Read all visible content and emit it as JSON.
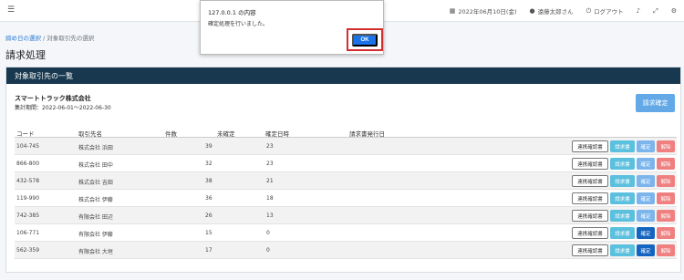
{
  "topbar": {
    "menu_icon": "hamburger-icon",
    "date_icon": "calendar-icon",
    "date": "2022年06月10日(金)",
    "user_icon": "user-icon",
    "user": "遠藤太郎さん",
    "logout_icon": "power-icon",
    "logout": "ログアウト",
    "icons": [
      "bell-icon",
      "expand-icon",
      "settings-icon"
    ]
  },
  "breadcrumb": {
    "link": "締め日の選択",
    "separator": "/",
    "current": "対象取引先の選択"
  },
  "page_title": "請求処理",
  "card": {
    "header": "対象取引先の一覧",
    "company": "スマートトラック株式会社",
    "period": "集計期間：2022-06-01〜2022-06-30",
    "confirm_button": "請求確定"
  },
  "table": {
    "headers": [
      "コード",
      "取引先名",
      "件数",
      "未確定",
      "確定日時",
      "請求書発行日"
    ],
    "rows": [
      {
        "code": "104-745",
        "name": "株式会社 浜田",
        "count": "",
        "unconfirmed": "39",
        "confirmed": "23",
        "issue": "",
        "confirm_active": false
      },
      {
        "code": "866-800",
        "name": "株式会社 田中",
        "count": "",
        "unconfirmed": "32",
        "confirmed": "23",
        "issue": "",
        "confirm_active": false
      },
      {
        "code": "432-578",
        "name": "株式会社 吉田",
        "count": "",
        "unconfirmed": "38",
        "confirmed": "21",
        "issue": "",
        "confirm_active": false
      },
      {
        "code": "119-990",
        "name": "株式会社 伊藤",
        "count": "",
        "unconfirmed": "36",
        "confirmed": "18",
        "issue": "",
        "confirm_active": false
      },
      {
        "code": "742-385",
        "name": "有限会社 田辺",
        "count": "",
        "unconfirmed": "26",
        "confirmed": "13",
        "issue": "",
        "confirm_active": false
      },
      {
        "code": "106-771",
        "name": "有限会社 伊藤",
        "count": "",
        "unconfirmed": "15",
        "confirmed": "0",
        "issue": "",
        "confirm_active": true
      },
      {
        "code": "562-359",
        "name": "有限会社 大垣",
        "count": "",
        "unconfirmed": "17",
        "confirmed": "0",
        "issue": "",
        "confirm_active": true
      }
    ],
    "row_actions": {
      "renkei": "連携確認書",
      "invoice": "請求書",
      "confirm": "確定",
      "release": "解除"
    }
  },
  "dialog": {
    "title": "127.0.0.1 の内容",
    "message": "確定処理を行いました。",
    "ok": "OK"
  },
  "colors": {
    "header_bg": "#17384f",
    "primary": "#1a73e8",
    "highlight": "#d32f2f"
  }
}
